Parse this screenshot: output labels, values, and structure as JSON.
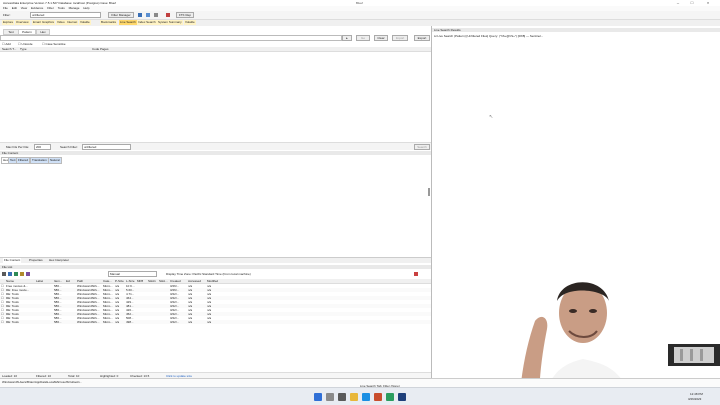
{
  "window": {
    "title": "AccessData Enterprise Version 7.5.1.527 Database: localhost (Postgres) Case: Bluef",
    "center_title": "Bluef"
  },
  "menu": [
    "File",
    "Edit",
    "View",
    "Evidence",
    "Filter",
    "Tools",
    "Manage",
    "Help"
  ],
  "toolbar": {
    "filter_label": "Filter:",
    "filter_value": "unfiltered",
    "filter_manager": "Filter Manager",
    "ftk_label": "FTK Rep"
  },
  "main_tabs": [
    "Explore",
    "Overview",
    "Email",
    "Graphics",
    "Video",
    "Internet",
    "Volatile",
    "Bookmarks",
    "Live Search",
    "Index Search",
    "System Summary",
    "Volatile"
  ],
  "left_subtabs": [
    "Text",
    "Pattern",
    "Hex"
  ],
  "search_bar": {
    "go": "Go",
    "clear": "Clear",
    "import": "Import",
    "export": "Export"
  },
  "options": {
    "add": "Add",
    "unicode": "Unicode",
    "case_sensitive": "Case Sensitive"
  },
  "term_columns": [
    "Search T...",
    "Type",
    "Code Pages"
  ],
  "max_hits": {
    "label": "Max hits Per File:",
    "value": "200",
    "search_filter_label": "Search Filter:",
    "search_filter_value": "unfiltered",
    "search_button": "Search"
  },
  "file_content": {
    "title": "File Content",
    "tabs": [
      "Hex",
      "Text",
      "Filtered",
      "Translation",
      "Natural"
    ]
  },
  "bottom_tabs": [
    "File Content",
    "Properties",
    "Hex Interpreter"
  ],
  "file_list": {
    "title": "File List",
    "view_value": "Manual",
    "timezone_note": "Display Time Zone: Pacific Standard Time (From local machine)",
    "columns": [
      "Name",
      "Label",
      "Item...",
      "Ext",
      "Path",
      "Cate...",
      "P-Size",
      "L-Size",
      "MD5",
      "SHA1",
      "SHA...",
      "Created",
      "Accessed",
      "Modified"
    ],
    "rows": [
      [
        "Free movies &...",
        "",
        "586...",
        "",
        "Windows10\\Rx...",
        "Micro...",
        "n/a",
        "10 K...",
        "",
        "",
        "",
        "3/26/...",
        "n/a",
        "n/a"
      ],
      [
        "RE: Free movie...",
        "",
        "586...",
        "",
        "Windows10\\Rx...",
        "Micro...",
        "n/a",
        "5.60...",
        "",
        "",
        "",
        "3/26/...",
        "n/a",
        "n/a"
      ],
      [
        "RE: Tools",
        "",
        "586...",
        "",
        "Windows10\\Rx...",
        "Micro...",
        "n/a",
        "4.71...",
        "",
        "",
        "",
        "3/22/...",
        "n/a",
        "n/a"
      ],
      [
        "RE: Tools",
        "",
        "586...",
        "",
        "Windows10\\Rx...",
        "Micro...",
        "n/a",
        "464...",
        "",
        "",
        "",
        "3/22/...",
        "n/a",
        "n/a"
      ],
      [
        "RE: Tools",
        "",
        "586...",
        "",
        "Windows10\\Rx...",
        "Micro...",
        "n/a",
        "429...",
        "",
        "",
        "",
        "3/22/...",
        "n/a",
        "n/a"
      ],
      [
        "RE: Tools",
        "",
        "586...",
        "",
        "Windows10\\Rx...",
        "Micro...",
        "n/a",
        "481...",
        "",
        "",
        "",
        "3/22/...",
        "n/a",
        "n/a"
      ],
      [
        "RE: Tools",
        "",
        "586...",
        "",
        "Windows10\\Rx...",
        "Micro...",
        "n/a",
        "426...",
        "",
        "",
        "",
        "3/22/...",
        "n/a",
        "n/a"
      ],
      [
        "RE: Tools",
        "",
        "586...",
        "",
        "Windows10\\Rx...",
        "Micro...",
        "n/a",
        "452...",
        "",
        "",
        "",
        "3/22/...",
        "n/a",
        "n/a"
      ],
      [
        "RE: Tools",
        "",
        "586...",
        "",
        "Windows10\\Rx...",
        "Micro...",
        "n/a",
        "508...",
        "",
        "",
        "",
        "3/22/...",
        "n/a",
        "n/a"
      ],
      [
        "RE: Tools",
        "",
        "586...",
        "",
        "Windows10\\Rx...",
        "Micro...",
        "n/a",
        "498...",
        "",
        "",
        "",
        "3/22/...",
        "n/a",
        "n/a"
      ]
    ]
  },
  "counts": {
    "loaded": "Loaded: 10",
    "filtered": "Filtered: 10",
    "total": "Total: 10",
    "highlighted": "Highlighted: 0",
    "checked": "Checked: 13.5",
    "totals_link": "Click to update size"
  },
  "live_results": {
    "title": "Live Search Results",
    "line": "Live Search (Pattern) [Unfiltered Files] Query: (\"\\\\S+@\\\\S+\") [RX8] — Sentinel..."
  },
  "status": {
    "path": "Windows10\\Users\\Brian\\AppData\\Local\\Microsoft\\Outlook\\...",
    "bottom": "Live Search Tab: Filter (None)"
  },
  "clock": {
    "time": "12:48 PM",
    "date": "3/26/2023"
  },
  "colors": {
    "accent": "#1e5fbf",
    "highlight": "#ffd86b",
    "tab_active": "#ffffff"
  }
}
